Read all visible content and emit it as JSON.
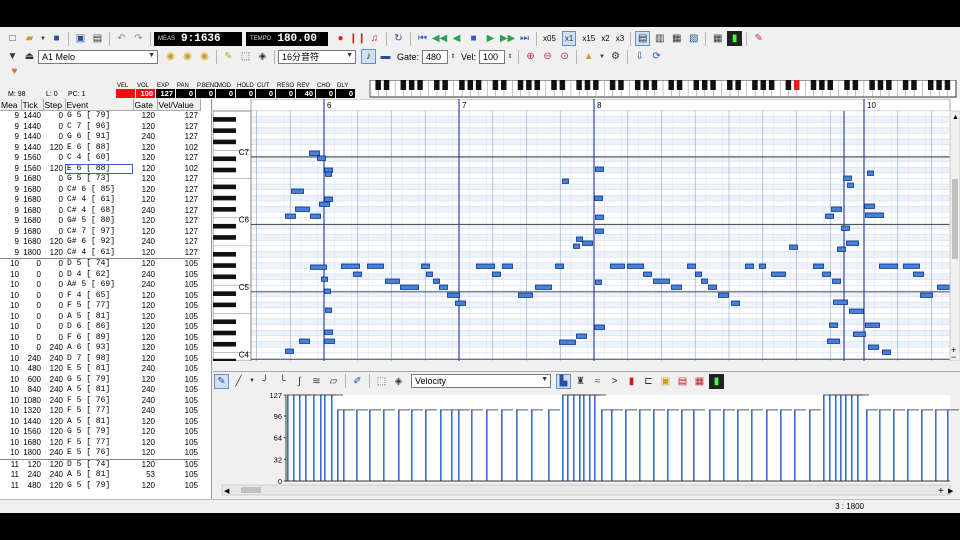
{
  "toolbar1": {
    "meas_label": "MEAS",
    "position": "9:1636",
    "tempo_label": "TEMPO",
    "tempo": "180.00",
    "mult_x05": "x05",
    "mult_x1": "x1",
    "mult_x15": "x15",
    "mult_x2": "x2",
    "mult_x3": "x3"
  },
  "toolbar2": {
    "track": "A1 Melo",
    "note_length": "16分音符",
    "gate_label": "Gate:",
    "gate_value": "480",
    "vel_label": "Vel:",
    "vel_value": "100"
  },
  "mixer": {
    "labels": [
      "VEL",
      "VOL",
      "EXP",
      "PAN",
      "P.BEND",
      "MOD",
      "HOLD",
      "CUT",
      "RESO",
      "REV",
      "CHO",
      "DLY"
    ],
    "values": [
      "",
      "100",
      "127",
      "0",
      "0",
      "0",
      "0",
      "0",
      "0",
      "40",
      "0",
      "0"
    ],
    "m_label": "M:",
    "m_value": "98",
    "l_label": "L:",
    "l_value": "0",
    "pc_label": "PC:",
    "pc_value": "1"
  },
  "event_list": {
    "headers": [
      "Mea",
      "Tick",
      "Step",
      "Event",
      "Gate",
      "Vel/Value"
    ],
    "rows": [
      [
        "9",
        "1440",
        "0",
        "G  5 [ 79]",
        "120",
        "127"
      ],
      [
        "9",
        "1440",
        "0",
        "C  7 [ 96]",
        "120",
        "127"
      ],
      [
        "9",
        "1440",
        "0",
        "G  6 [ 91]",
        "240",
        "127"
      ],
      [
        "9",
        "1440",
        "120",
        "E  6 [ 88]",
        "120",
        "102"
      ],
      [
        "9",
        "1560",
        "0",
        "C  4 [ 60]",
        "120",
        "127"
      ],
      [
        "9",
        "1560",
        "120",
        "E  6 [ 88]",
        "120",
        "102"
      ],
      [
        "9",
        "1680",
        "0",
        "G  5 [ 73]",
        "120",
        "127"
      ],
      [
        "9",
        "1680",
        "0",
        "C# 6 [ 85]",
        "120",
        "127"
      ],
      [
        "9",
        "1680",
        "0",
        "C# 4 [ 61]",
        "120",
        "127"
      ],
      [
        "9",
        "1680",
        "0",
        "C# 4 [ 68]",
        "240",
        "127"
      ],
      [
        "9",
        "1680",
        "0",
        "G# 5 [ 80]",
        "120",
        "127"
      ],
      [
        "9",
        "1680",
        "0",
        "C# 7 [ 97]",
        "120",
        "127"
      ],
      [
        "9",
        "1680",
        "120",
        "G# 6 [ 92]",
        "240",
        "127"
      ],
      [
        "9",
        "1800",
        "120",
        "C# 4 [ 61]",
        "120",
        "127"
      ],
      [
        "10",
        "0",
        "0",
        "D  5 [ 74]",
        "120",
        "105"
      ],
      [
        "10",
        "0",
        "0",
        "D  4 [ 62]",
        "240",
        "105"
      ],
      [
        "10",
        "0",
        "0",
        "A# 5 [ 69]",
        "240",
        "105"
      ],
      [
        "10",
        "0",
        "0",
        "F  4 [ 65]",
        "120",
        "105"
      ],
      [
        "10",
        "0",
        "0",
        "F  5 [ 77]",
        "120",
        "105"
      ],
      [
        "10",
        "0",
        "0",
        "A  5 [ 81]",
        "120",
        "105"
      ],
      [
        "10",
        "0",
        "0",
        "D  6 [ 86]",
        "120",
        "105"
      ],
      [
        "10",
        "0",
        "0",
        "F  6 [ 89]",
        "120",
        "105"
      ],
      [
        "10",
        "0",
        "240",
        "A  6 [ 93]",
        "120",
        "105"
      ],
      [
        "10",
        "240",
        "240",
        "D  7 [ 98]",
        "120",
        "105"
      ],
      [
        "10",
        "480",
        "120",
        "E  5 [ 81]",
        "240",
        "105"
      ],
      [
        "10",
        "600",
        "240",
        "G  5 [ 79]",
        "120",
        "105"
      ],
      [
        "10",
        "840",
        "240",
        "A  5 [ 81]",
        "240",
        "105"
      ],
      [
        "10",
        "1080",
        "240",
        "F  5 [ 76]",
        "240",
        "105"
      ],
      [
        "10",
        "1320",
        "120",
        "F  5 [ 77]",
        "240",
        "105"
      ],
      [
        "10",
        "1440",
        "120",
        "A  5 [ 81]",
        "120",
        "105"
      ],
      [
        "10",
        "1560",
        "120",
        "G  5 [ 79]",
        "120",
        "105"
      ],
      [
        "10",
        "1680",
        "120",
        "F  5 [ 77]",
        "120",
        "105"
      ],
      [
        "10",
        "1800",
        "240",
        "E  5 [ 76]",
        "120",
        "105"
      ],
      [
        "11",
        "120",
        "120",
        "D  5 [ 74]",
        "120",
        "105"
      ],
      [
        "11",
        "240",
        "240",
        "A  5 [ 81]",
        "53",
        "105"
      ],
      [
        "11",
        "480",
        "120",
        "G  5 [ 79]",
        "120",
        "105"
      ]
    ]
  },
  "piano_roll": {
    "measures": [
      "6",
      "7",
      "8",
      "10"
    ],
    "octave_labels": [
      "C7",
      "C6",
      "C5",
      "C4"
    ]
  },
  "velocity_panel": {
    "property": "Velocity",
    "axis_labels": [
      "127",
      "96",
      "64",
      "32",
      "0"
    ]
  },
  "status_bar": {
    "position": "3 : 1800"
  },
  "colors": {
    "note_fill": "#4a7fd8",
    "note_border": "#00308a",
    "measure_line": "#3344aa",
    "grid_light": "#c8d8ee",
    "meter_red": "#ee1111"
  }
}
